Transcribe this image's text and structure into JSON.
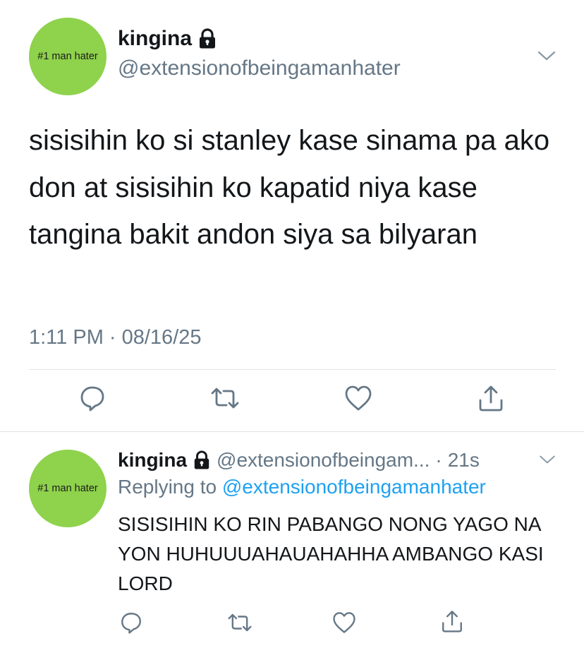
{
  "main_tweet": {
    "avatar_text": "#1 man hater",
    "display_name": "kingina",
    "handle": "@extensionofbeingamanhater",
    "text": "sisisihin ko si stanley kase sinama pa ako don at sisisihin ko kapatid niya kase tangina bakit andon siya sa bilyaran",
    "timestamp": "1:11 PM · 08/16/25"
  },
  "reply_tweet": {
    "avatar_text": "#1 man hater",
    "display_name": "kingina",
    "handle": "@extensionofbeingam...",
    "separator": "·",
    "time": "21s",
    "replying_to_label": "Replying to",
    "replying_to_handle": "@extensionofbeingamanhater",
    "text": "SISISIHIN KO RIN PABANGO NONG YAGO NA YON HUHUUUAHAUAHAHHA AMBANGO KASI LORD"
  },
  "icons": {
    "lock": "lock-icon",
    "chevron": "chevron-down-icon",
    "reply": "reply-icon",
    "retweet": "retweet-icon",
    "like": "like-icon",
    "share": "share-icon"
  },
  "colors": {
    "avatar_bg": "#8fd24c",
    "text_primary": "#14171a",
    "text_secondary": "#657786",
    "link": "#1da1f2",
    "divider": "#dfe3e7",
    "icon": "#657786"
  }
}
